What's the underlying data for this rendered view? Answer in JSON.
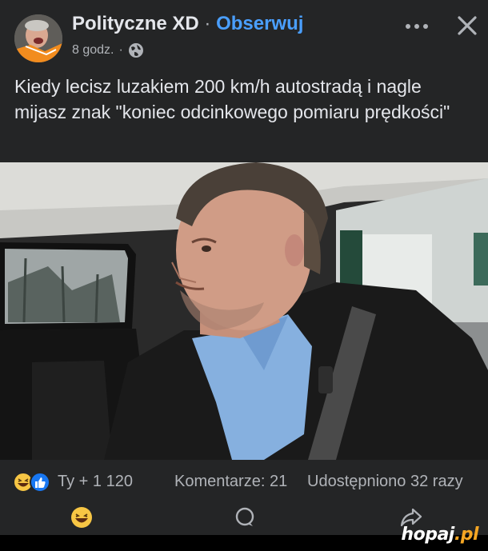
{
  "post": {
    "page_name": "Polityczne XD",
    "separator": "·",
    "follow_label": "Obserwuj",
    "time": "8 godz.",
    "time_separator": "·",
    "privacy_icon": "globe-icon",
    "caption": "Kiedy lecisz luzakiem 200 km/h autostradą i nagle mijasz znak \"koniec odcinkowego pomiaru prędkości\""
  },
  "header_actions": {
    "more_icon": "more-horizontal-icon",
    "close_icon": "close-icon"
  },
  "reactions": {
    "icons": [
      "haha-emoji-icon",
      "like-icon"
    ],
    "count_text": "Ty + 1 120",
    "comments_text": "Komentarze: 21",
    "shares_text": "Udostępniono 32 razy"
  },
  "actions": [
    {
      "name": "react-button",
      "icon": "haha-emoji-icon"
    },
    {
      "name": "comment-button",
      "icon": "comment-icon"
    },
    {
      "name": "share-button",
      "icon": "share-icon"
    }
  ],
  "watermark": {
    "text": "hopaj",
    "suffix": ".pl"
  },
  "colors": {
    "background": "#242526",
    "text": "#e4e6eb",
    "muted": "#b0b3b8",
    "link": "#4a9fff",
    "like_blue": "#1877f2",
    "haha_yellow": "#f7c644"
  }
}
